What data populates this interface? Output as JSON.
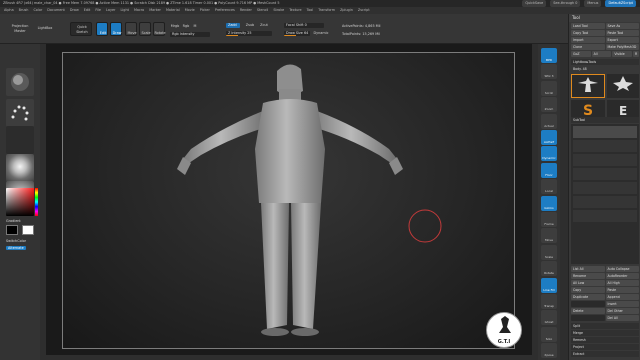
{
  "title_bar": {
    "app": "ZBrush 4R7 (x64)",
    "file": "  male_char_04",
    "stats": "  ● Free Mem 7.09768  ● Active Mem 1131  ● Scratch Disk 2189  ● ZTime 1.618 Timer 0.001  ● PolyCount 9.716 MP  ● MeshCount 5",
    "quicksave": "QuickSave",
    "seethrough": "See-through  0",
    "menus": "Menus",
    "script": "DefaultZScript"
  },
  "menubar": {
    "items": [
      "Alpha",
      "Brush",
      "Color",
      "Document",
      "Draw",
      "Edit",
      "File",
      "Layer",
      "Light",
      "Macro",
      "Marker",
      "Material",
      "Movie",
      "Picker",
      "Preferences",
      "Render",
      "Stencil",
      "Stroke",
      "Texture",
      "Tool",
      "Transform",
      "Zplugin",
      "Zscript"
    ]
  },
  "shelf": {
    "projection_master": "Projection Master",
    "lightbox": "LightBox",
    "quick_sketch": "Quick Sketch",
    "edit": "Edit",
    "draw": "Draw",
    "move": "Move",
    "scale": "Scale",
    "rotate": "Rotate",
    "mrgb": "Mrgb",
    "rgb": "Rgb",
    "m": "M",
    "zadd": "Zadd",
    "zsub": "Zsub",
    "zcut": "Zcut",
    "rgb_intensity": "Rgb Intensity",
    "z_intensity": "Z Intensity 25",
    "focal_shift": "Focal Shift 0",
    "draw_size": "Draw Size 64",
    "dynamic": "Dynamic",
    "active_points": "ActivePoints: 4,865 Mil",
    "total_points": "TotalPoints: 15,269 Mil"
  },
  "left_shelf": {
    "gradient": "Gradient",
    "switch_color": "SwitchColor",
    "alternate": "Alternate"
  },
  "rail": {
    "buttons": [
      "BPR",
      "SPix 3",
      "Scroll",
      "Zoom",
      "Actual",
      "AAHalf",
      "Dynamic Persp",
      "Floor",
      "Local",
      "Gizmo",
      "Frame",
      "Move",
      "Scale",
      "Rotate",
      "Line Fill PolyF",
      "Transp",
      "Ghost",
      "Solo",
      "Xpose"
    ]
  },
  "panel": {
    "header": "Tool",
    "load_tool": "Load Tool",
    "save_as": "Save As",
    "copy_tool": "Copy Tool",
    "paste_tool": "Paste Tool",
    "import": "Import",
    "export": "Export",
    "clone": "Clone",
    "make_polymesh": "Make PolyMesh3D",
    "goz": "GoZ",
    "all": "All",
    "visible": "Visible",
    "r": "R",
    "lightbox_tools": "Lightbox▸Tools",
    "body_label": "Body. 48",
    "subtool": "SubTool",
    "list_all": "List All",
    "auto_collapse": "Auto Collapse",
    "rename": "Rename",
    "autoreorder": "AutoReorder",
    "all_low": "All Low",
    "all_high": "All High",
    "copy": "Copy",
    "paste": "Paste",
    "duplicate": "Duplicate",
    "append": "Append",
    "insert": "Insert",
    "delete": "Delete",
    "del_other": "Del Other",
    "del_all": "Del All",
    "split": "Split",
    "merge": "Merge",
    "remesh": "Remesh",
    "project": "Project",
    "extract": "Extract"
  },
  "watermark": {
    "text": "G.T.I"
  },
  "colors": {
    "accent": "#1d7dc4",
    "orange": "#e08a1e",
    "panel_bg": "#383838"
  }
}
